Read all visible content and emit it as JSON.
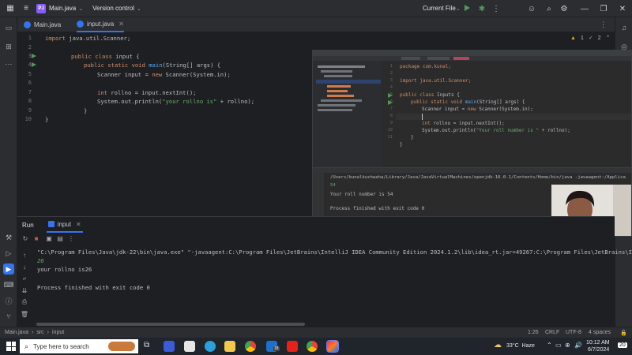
{
  "titlebar": {
    "project_badge": "PJ",
    "file_name": "Main.java",
    "vcs_label": "Version control",
    "run_config": "Current File"
  },
  "tabs": [
    {
      "label": "Main.java"
    },
    {
      "label": "input.java"
    }
  ],
  "editor": {
    "inspection": {
      "warnings": "1",
      "weak_warnings": "2"
    },
    "line_numbers": [
      "1",
      "2",
      "3",
      "4",
      "5",
      "6",
      "7",
      "8",
      "9",
      "10"
    ],
    "line1": {
      "kw": "import",
      "rest": " java.util.Scanner;"
    },
    "line3": {
      "kw1": "public",
      "kw2": "class",
      "rest": " input {"
    },
    "line4": {
      "kw1": "public",
      "kw2": "static",
      "kw3": "void",
      "fn": "main",
      "rest": "(String[] args) {"
    },
    "line5": {
      "a": "Scanner input = ",
      "kw": "new",
      "b": " Scanner(System.in);"
    },
    "line7": {
      "kw": "int",
      "b": " rollno = input.nextInt();"
    },
    "line8": {
      "a": "System.out.println(",
      "str": "\"your rollno is\"",
      "b": " + rollno);"
    },
    "line9": {
      "a": "}"
    },
    "line10": {
      "a": "}"
    }
  },
  "overlay": {
    "line_numbers": [
      "1",
      "2",
      "3",
      "4",
      "5",
      "6",
      "7",
      "8",
      "9",
      "10",
      "11"
    ],
    "code": {
      "l1": "package com.kunal;",
      "l3": "import java.util.Scanner;",
      "l5a": "public class",
      "l5b": " Inputs {",
      "l6a": "public static void",
      "l6fn": " main",
      "l6b": "(String[] args) {",
      "l7a": "Scanner input = ",
      "l7kw": "new",
      "l7b": " Scanner(System.in);",
      "l9kw": "int",
      "l9b": " rollno = input.nextInt();",
      "l10a": "System.out.println(",
      "l10str": "\"Your roll number is \"",
      "l10b": " + rollno);",
      "l11": "}",
      "l12": "}"
    },
    "console": {
      "cmd": "/Users/kunalkushwaha/Library/Java/JavaVirtualMachines/openjdk-16.0.1/Contents/Home/bin/java -javaagent:/Applica",
      "input": "54",
      "output": "Your roll number is 54",
      "exit": "Process finished with exit code 0"
    }
  },
  "run_panel": {
    "title": "Run",
    "tab_label": "input",
    "cmd": "\"C:\\Program Files\\Java\\jdk-22\\bin\\java.exe\" \"-javaagent:C:\\Program Files\\JetBrains\\IntelliJ IDEA Community Edition 2024.1.2\\lib\\idea_rt.jar=49267:C:\\Program Files\\JetBrains\\Int",
    "user_input": "26",
    "output": "your rollno is26",
    "exit": "Process finished with exit code 0"
  },
  "statusbar": {
    "breadcrumb": [
      "Main.java",
      "src",
      "input"
    ],
    "position": "1:26",
    "line_sep": "CRLF",
    "encoding": "UTF-8",
    "indent": "4 spaces"
  },
  "taskbar": {
    "search_placeholder": "Type here to search",
    "weather": "33°C  Haze",
    "time": "10:12 AM",
    "date": "6/7/2024",
    "notifications": "20",
    "mail_badge": "18"
  },
  "colors": {
    "keyword": "#cf8e6d",
    "function": "#56a8f5",
    "string": "#6aab73",
    "accent": "#3574f0",
    "run_green": "#57965c",
    "console_input": "#6aab73"
  }
}
